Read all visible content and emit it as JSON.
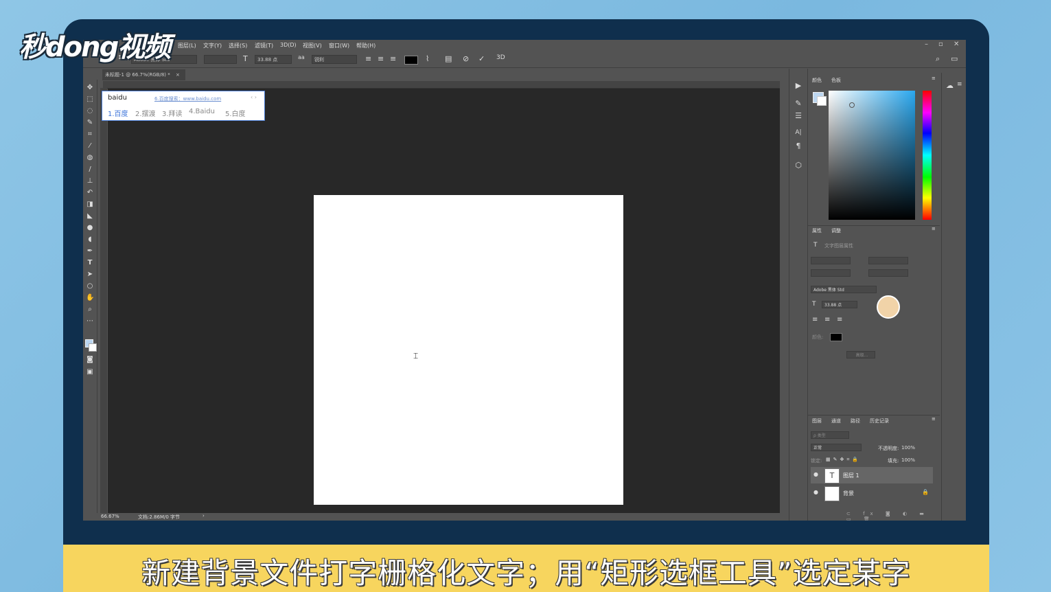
{
  "logo": "秒dong视频",
  "menu": [
    "图层(L)",
    "文字(Y)",
    "选择(S)",
    "滤镜(T)",
    "3D(D)",
    "视图(V)",
    "窗口(W)",
    "帮助(H)"
  ],
  "options": {
    "font_family": "Adobe 黑体 Std",
    "font_size": "33.88 点",
    "antialias": "锐利",
    "three_d": "3D"
  },
  "doc_tab": "未标题-1 @ 66.7%(RGB/8) *",
  "ime": {
    "input": "baidu",
    "hint": "6.百度搜索：www.baidu.com",
    "candidates": [
      "1.百度",
      "2.摆渡",
      "3.拜读",
      "4.Baidu",
      "5.白度"
    ]
  },
  "status": {
    "zoom": "66.67%",
    "doc": "文档:2.86M/0 字节"
  },
  "panels": {
    "color_tabs": [
      "颜色",
      "色板"
    ],
    "props_tabs": [
      "属性",
      "调整"
    ],
    "props_title": "文字图层属性",
    "props_font": "Adobe 黑体 Std",
    "props_size": "33.88 点",
    "props_color_label": "颜色:",
    "props_more": "高级...",
    "layer_tabs": [
      "图层",
      "通道",
      "路径",
      "历史记录"
    ],
    "layer_filter": "ρ 类型",
    "blend_mode": "正常",
    "opacity_label": "不透明度:",
    "opacity": "100%",
    "lock_label": "锁定:",
    "fill_label": "填充:",
    "fill": "100%",
    "layers": [
      {
        "name": "图层 1",
        "type": "text"
      },
      {
        "name": "背景",
        "type": "background"
      }
    ]
  },
  "caption": "新建背景文件打字栅格化文字；用“矩形选框工具”选定某字",
  "colors": {
    "accent": "#f7d55e",
    "monitor": "#0f2f4d",
    "ps_bg": "#535353",
    "canvas_bg": "#282828"
  }
}
